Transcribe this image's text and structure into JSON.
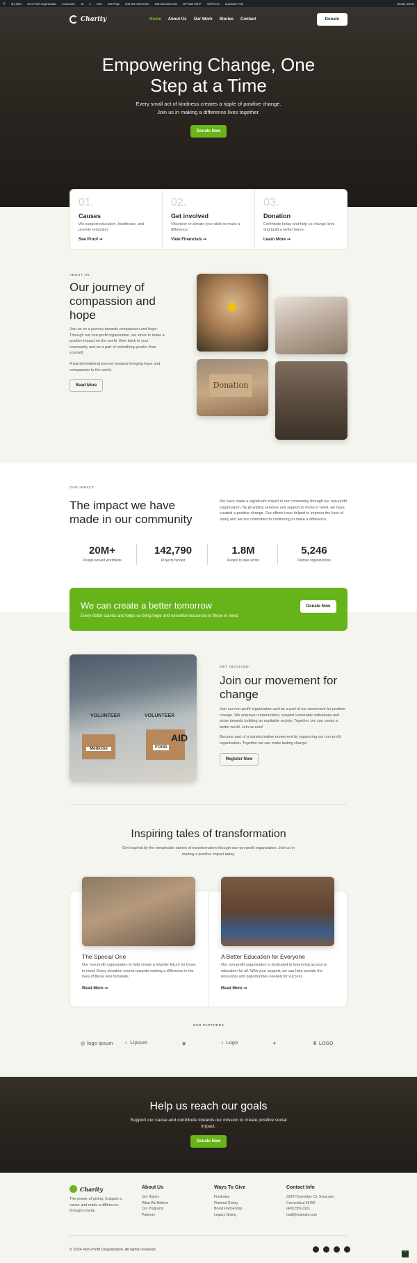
{
  "adminbar": {
    "items": [
      "My Sites",
      "Non-Profit Organization",
      "Customize",
      "16",
      "0",
      "New",
      "Edit Page",
      "Edit with Elementor",
      "Edit this Astra Site",
      "WP Mail SMTP",
      "WPForms",
      "Duplicate Post"
    ],
    "user": "Howdy, admin"
  },
  "nav": {
    "logo": "Charity",
    "items": [
      "Home",
      "About Us",
      "Our Work",
      "Stories",
      "Contact"
    ],
    "cta": "Donate"
  },
  "hero": {
    "title_line1": "Empowering Change, One",
    "title_line2": "Step at a Time",
    "subtitle_line1": "Every small act of kindness creates a ripple of positive change.",
    "subtitle_line2": "Join us in making a difference lives together.",
    "button": "Donate Now"
  },
  "features": [
    {
      "num": "01.",
      "title": "Causes",
      "text": "We support education, healthcare, and poverty reduction.",
      "link": "See Proof"
    },
    {
      "num": "02.",
      "title": "Get involved",
      "text": "Volunteer or donate your skills to make a difference.",
      "link": "View Financials"
    },
    {
      "num": "03.",
      "title": "Donation",
      "text": "Contribute today and help us change lives and build a better future.",
      "link": "Learn More"
    }
  ],
  "about": {
    "eyebrow": "ABOUT US",
    "title": "Our journey of compassion and hope",
    "p1": "Join us on a journey towards compassion and hope. Through our non-profit organization, we strive to make a positive impact on the world. Give back to your community and be a part of something greater than yourself.",
    "p2": "A transformational journey towards bringing hope and compassion to the world.",
    "button": "Read More",
    "donation_sign": "Donation"
  },
  "impact": {
    "eyebrow": "OUR IMPACT",
    "title": "The impact we have made in our community",
    "text": "We have made a significant impact in our community through our non-profit organization. By providing services and support to those in need, we have created a positive change. Our efforts have helped to improve the lives of many and we are committed to continuing to make a difference.",
    "stats": [
      {
        "value": "20M+",
        "label": "People served worldwide"
      },
      {
        "value": "142,790",
        "label": "Projects funded"
      },
      {
        "value": "1.8M",
        "label": "People to take action"
      },
      {
        "value": "5,246",
        "label": "Partner organizations"
      }
    ]
  },
  "banner": {
    "title": "We can create a better tomorrow",
    "text": "Every dollar counts and helps us bring hope and essential resources to those in need.",
    "button": "Donate Now"
  },
  "involved": {
    "eyebrow": "GET INVOLVED",
    "title": "Join our movement for change",
    "p1": "Join our non-profit organization and be a part of our movement for positive change. We empower communities, support vulnerable individuals and strive towards building an equitable society. Together, we can create a better world. Join us now!",
    "p2": "Become part of a transformative movement by supporting our non-profit organization. Together we can make lasting change.",
    "button": "Register Now",
    "shirt": "VOLUNTEER",
    "box1": "Medicine",
    "box2": "FOOD",
    "box2b": "AID"
  },
  "stories": {
    "title": "Inspiring tales of transformation",
    "subtitle": "Get inspired by the remarkable stories of transformation through our non-profit organization. Join us in making a positive impact today.",
    "items": [
      {
        "title": "The Special One",
        "text": "Our non-profit organization to help create a brighter future for those in need. Every donation counts towards making a difference in the lives of those less fortunate.",
        "link": "Read More"
      },
      {
        "title": "A Better Education for Everyone",
        "text": "Our non-profit organization is dedicated to improving access to education for all. With your support, we can help provide the resources and opportunities needed for success.",
        "link": "Read More"
      }
    ]
  },
  "partners": {
    "eyebrow": "OUR PARTNERS",
    "logos": [
      "logo ipsum",
      "Lipsum",
      "",
      "Logo",
      "",
      "LOGO"
    ]
  },
  "cta": {
    "title": "Help us reach our goals",
    "text": "Support our cause and contribute towards our mission to create positive social impact.",
    "button": "Donate Now"
  },
  "footer": {
    "logo": "Charity",
    "tagline": "The power of giving: Support a cause and make a difference through charity.",
    "cols": [
      {
        "title": "About Us",
        "links": [
          "Our History",
          "What We Believe",
          "Our Programs",
          "Partners"
        ]
      },
      {
        "title": "Ways To Give",
        "links": [
          "Fundraise",
          "Planned Giving",
          "Brand Partnership",
          "Legacy Giving"
        ]
      },
      {
        "title": "Contact Info",
        "links": [
          "3234 Thornridge Cir. Syracuse,",
          "Connecticut 56789",
          "(406) 555-0121",
          "mail@example.com"
        ]
      }
    ],
    "copyright": "© 2024 Non-Profit Organization. All rights reserved.",
    "social": [
      "facebook-icon",
      "twitter-icon",
      "instagram-icon",
      "youtube-icon"
    ]
  },
  "colors": {
    "accent": "#6ab417",
    "dark": "#1f2a1f",
    "bg": "#f4f5ee"
  }
}
